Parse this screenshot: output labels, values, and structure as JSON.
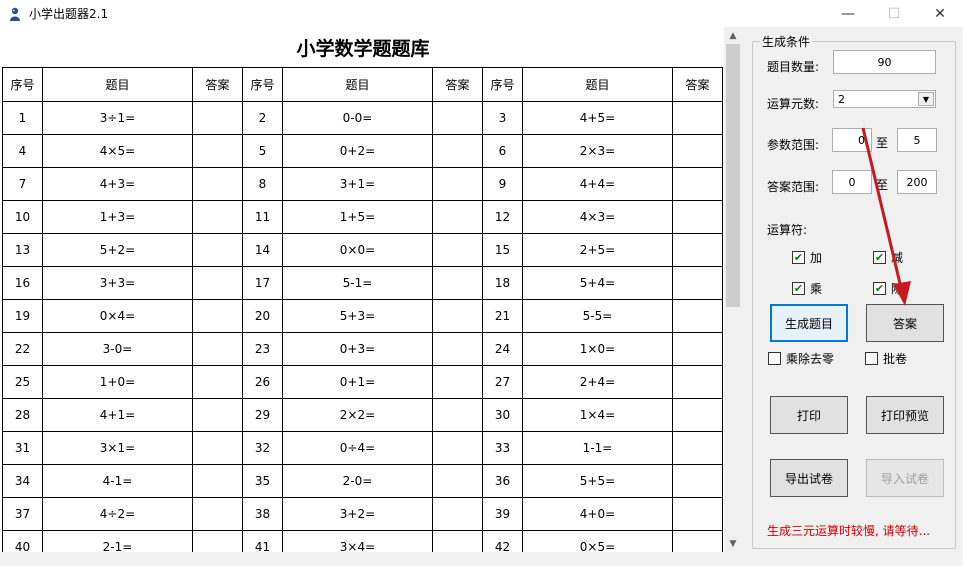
{
  "window": {
    "title": "小学出题器2.1",
    "minimize": "—",
    "maximize": "☐",
    "close": "✕"
  },
  "sheet": {
    "title": "小学数学题题库",
    "headers": [
      "序号",
      "题目",
      "答案",
      "序号",
      "题目",
      "答案",
      "序号",
      "题目",
      "答案"
    ],
    "rows": [
      [
        "1",
        "3÷1=",
        "",
        "2",
        "0-0=",
        "",
        "3",
        "4+5="
      ],
      [
        "4",
        "4×5=",
        "",
        "5",
        "0+2=",
        "",
        "6",
        "2×3="
      ],
      [
        "7",
        "4+3=",
        "",
        "8",
        "3+1=",
        "",
        "9",
        "4+4="
      ],
      [
        "10",
        "1+3=",
        "",
        "11",
        "1+5=",
        "",
        "12",
        "4×3="
      ],
      [
        "13",
        "5+2=",
        "",
        "14",
        "0×0=",
        "",
        "15",
        "2+5="
      ],
      [
        "16",
        "3+3=",
        "",
        "17",
        "5-1=",
        "",
        "18",
        "5+4="
      ],
      [
        "19",
        "0×4=",
        "",
        "20",
        "5+3=",
        "",
        "21",
        "5-5="
      ],
      [
        "22",
        "3-0=",
        "",
        "23",
        "0+3=",
        "",
        "24",
        "1×0="
      ],
      [
        "25",
        "1+0=",
        "",
        "26",
        "0+1=",
        "",
        "27",
        "2+4="
      ],
      [
        "28",
        "4+1=",
        "",
        "29",
        "2×2=",
        "",
        "30",
        "1×4="
      ],
      [
        "31",
        "3×1=",
        "",
        "32",
        "0÷4=",
        "",
        "33",
        "1-1="
      ],
      [
        "34",
        "4-1=",
        "",
        "35",
        "2-0=",
        "",
        "36",
        "5+5="
      ],
      [
        "37",
        "4÷2=",
        "",
        "38",
        "3+2=",
        "",
        "39",
        "4+0="
      ],
      [
        "40",
        "2-1=",
        "",
        "41",
        "3×4=",
        "",
        "42",
        "0×5="
      ]
    ]
  },
  "panel": {
    "group_title": "生成条件",
    "count_label": "题目数量:",
    "count_value": "90",
    "elements_label": "运算元数:",
    "elements_value": "2",
    "param_label": "参数范围:",
    "param_min": "0",
    "param_to": "至",
    "param_max": "5",
    "answer_label": "答案范围:",
    "answer_min": "0",
    "answer_to": "至",
    "answer_max": "200",
    "ops_label": "运算符:",
    "op_add": "加",
    "op_sub": "减",
    "op_mul": "乘",
    "op_div": "除",
    "btn_generate": "生成题目",
    "btn_answer": "答案",
    "chk_nozero": "乘除去零",
    "chk_grade": "批卷",
    "btn_print": "打印",
    "btn_preview": "打印预览",
    "btn_export": "导出试卷",
    "btn_import": "导入试卷",
    "note": "生成三元运算时较慢, 请等待..."
  },
  "colors": {
    "accent": "#0078d7",
    "note": "#d40000",
    "arrow": "#c8191e"
  }
}
